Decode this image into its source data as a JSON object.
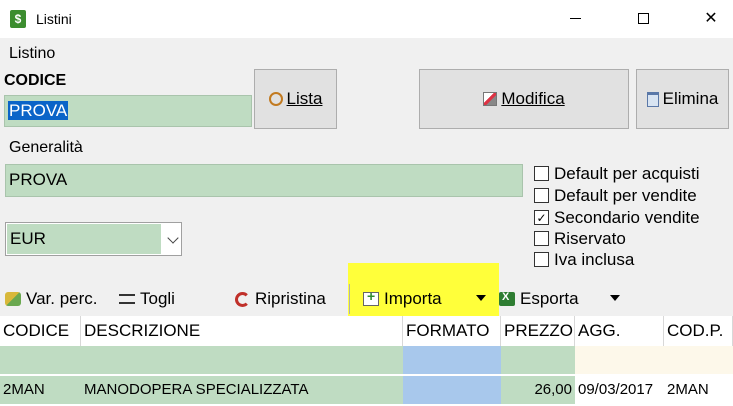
{
  "window": {
    "title": "Listini",
    "app_icon_glyph": "$",
    "minimize_icon": "minimize-icon",
    "maximize_icon": "maximize-icon",
    "close_glyph": "✕"
  },
  "section_listino": {
    "label": "Listino",
    "codice_label": "CODICE",
    "codice_value": "PROVA"
  },
  "buttons": {
    "lista": {
      "label": "Lista",
      "icon": "magnifier-icon"
    },
    "modifica": {
      "label": "Modifica",
      "icon": "pencil-icon"
    },
    "elimina": {
      "label": "Elimina",
      "icon": "delete-icon"
    }
  },
  "section_generalita": {
    "label": "Generalità",
    "descrizione_value": "PROVA",
    "valuta_value": "EUR"
  },
  "checkboxes": [
    {
      "label": "Default per acquisti",
      "checked": false
    },
    {
      "label": "Default per vendite",
      "checked": false
    },
    {
      "label": "Secondario vendite",
      "checked": true,
      "mark": "✓"
    },
    {
      "label": "Riservato",
      "checked": false
    },
    {
      "label": "Iva inclusa",
      "checked": false
    }
  ],
  "toolbar": {
    "var_perc": "Var. perc.",
    "togli": "Togli",
    "ripristina": "Ripristina",
    "importa": "Importa",
    "esporta": "Esporta",
    "highlight_color": "#ffff3a"
  },
  "grid": {
    "columns": [
      "CODICE",
      "DESCRIZIONE",
      "FORMATO",
      "PREZZO",
      "AGG.",
      "COD.P."
    ],
    "rows": [
      {
        "codice": "2MAN",
        "descrizione": "MANODOPERA SPECIALIZZATA",
        "formato": "",
        "prezzo": "26,00",
        "agg": "09/03/2017",
        "codp": "2MAN"
      }
    ]
  },
  "colors": {
    "field_green": "#bfdcc2",
    "column_blue": "#a8c8ec",
    "selection_blue": "#0a64c8"
  }
}
